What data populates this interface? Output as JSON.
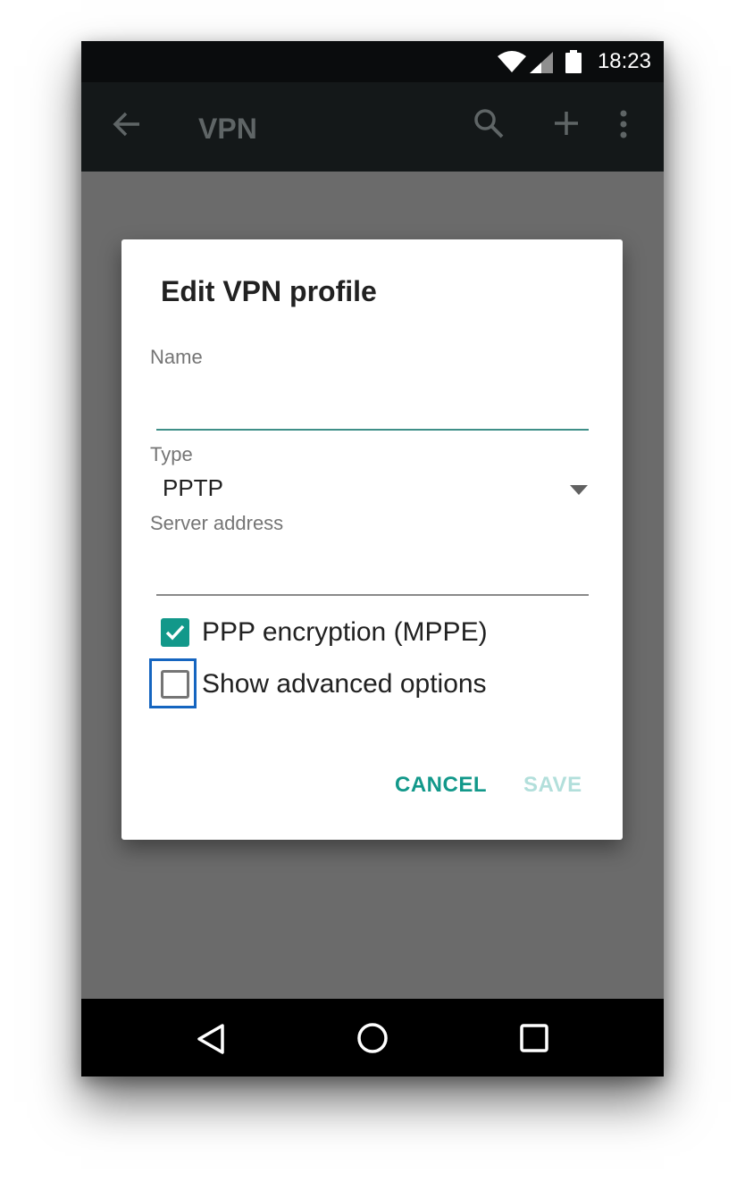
{
  "status_bar": {
    "time": "18:23",
    "icons": [
      "wifi-icon",
      "cell-signal-icon",
      "battery-icon"
    ]
  },
  "app_bar": {
    "title": "VPN",
    "icons": [
      "back-arrow-icon",
      "search-icon",
      "add-icon",
      "more-vert-icon"
    ]
  },
  "dialog": {
    "title": "Edit VPN profile",
    "name_label": "Name",
    "name_value": "",
    "type_label": "Type",
    "type_value": "PPTP",
    "server_label": "Server address",
    "server_value": "",
    "ppp_encryption_label": "PPP encryption (MPPE)",
    "ppp_encryption_checked": true,
    "advanced_label": "Show advanced options",
    "advanced_checked": false,
    "cancel_label": "CANCEL",
    "save_label": "SAVE"
  },
  "nav_bar": {
    "icons": [
      "back-triangle-icon",
      "home-circle-icon",
      "recents-square-icon"
    ]
  },
  "colors": {
    "accent": "#12988a",
    "save_disabled": "#b2dfdb",
    "focus_ring": "#1565c0"
  }
}
